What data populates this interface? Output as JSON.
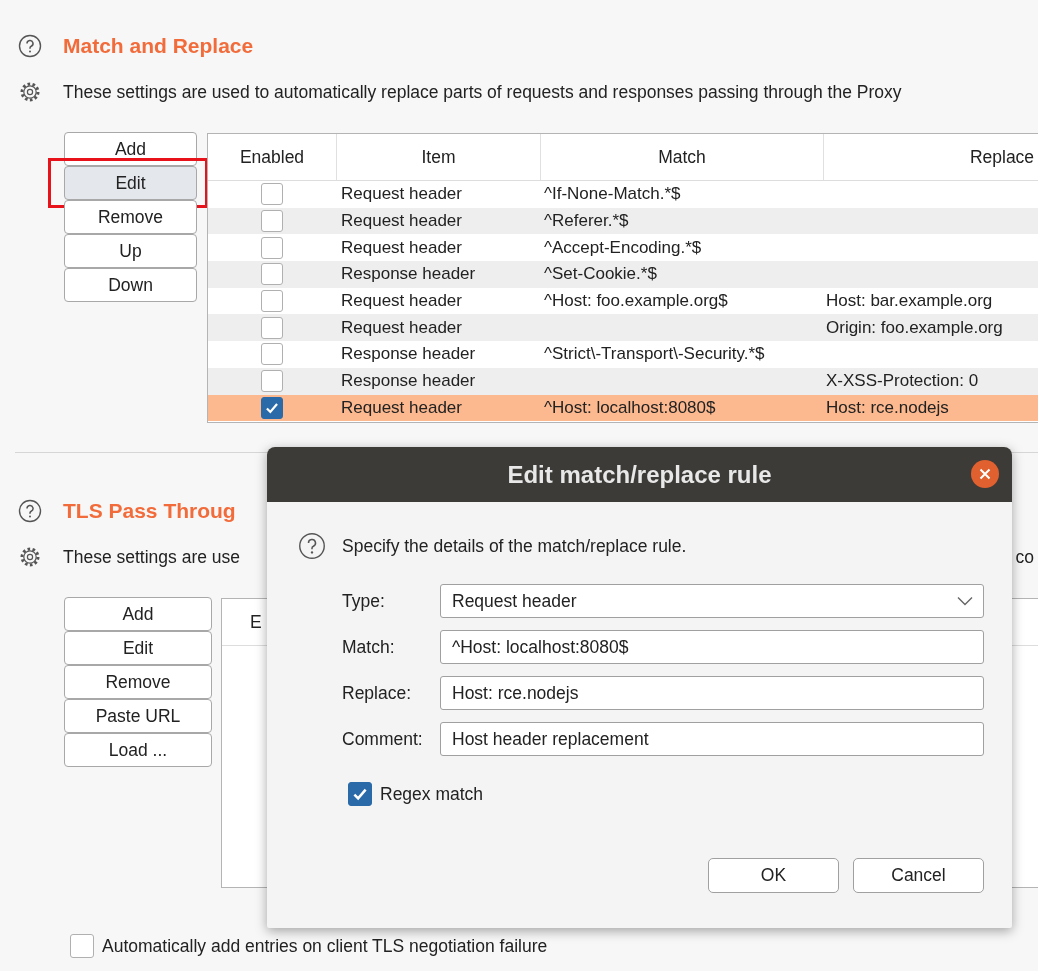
{
  "sections": [
    {
      "title": "Match and Replace",
      "description": "These settings are used to automatically replace parts of requests and responses passing through the Proxy",
      "buttons": [
        {
          "label": "Add",
          "annotated": false
        },
        {
          "label": "Edit",
          "annotated": true
        },
        {
          "label": "Remove",
          "annotated": false
        },
        {
          "label": "Up",
          "annotated": false
        },
        {
          "label": "Down",
          "annotated": false
        }
      ],
      "table": {
        "columns": [
          "Enabled",
          "Item",
          "Match",
          "Replace"
        ],
        "rows": [
          {
            "enabled": false,
            "item": "Request header",
            "match": "^If-None-Match.*$",
            "replace": "",
            "selected": false
          },
          {
            "enabled": false,
            "item": "Request header",
            "match": "^Referer.*$",
            "replace": "",
            "selected": false
          },
          {
            "enabled": false,
            "item": "Request header",
            "match": "^Accept-Encoding.*$",
            "replace": "",
            "selected": false
          },
          {
            "enabled": false,
            "item": "Response header",
            "match": "^Set-Cookie.*$",
            "replace": "",
            "selected": false
          },
          {
            "enabled": false,
            "item": "Request header",
            "match": "^Host: foo.example.org$",
            "replace": "Host: bar.example.org",
            "selected": false
          },
          {
            "enabled": false,
            "item": "Request header",
            "match": "",
            "replace": "Origin: foo.example.org",
            "selected": false
          },
          {
            "enabled": false,
            "item": "Response header",
            "match": "^Strict\\-Transport\\-Security.*$",
            "replace": "",
            "selected": false
          },
          {
            "enabled": false,
            "item": "Response header",
            "match": "",
            "replace": "X-XSS-Protection: 0",
            "selected": false
          },
          {
            "enabled": true,
            "item": "Request header",
            "match": "^Host: localhost:8080$",
            "replace": "Host: rce.nodejs",
            "selected": true
          }
        ]
      }
    },
    {
      "title": "TLS Pass Throug",
      "description": "These settings are use",
      "description_tail": "co",
      "buttons": [
        {
          "label": "Add",
          "annotated": false
        },
        {
          "label": "Edit",
          "annotated": false
        },
        {
          "label": "Remove",
          "annotated": false
        },
        {
          "label": "Paste URL",
          "annotated": false
        },
        {
          "label": "Load ...",
          "annotated": false
        }
      ],
      "table": {
        "columns": [
          "E"
        ]
      }
    }
  ],
  "footer_checkbox": {
    "label": "Automatically add entries on client TLS negotiation failure",
    "checked": false
  },
  "dialog": {
    "title": "Edit match/replace rule",
    "prompt": "Specify the details of the match/replace rule.",
    "fields": [
      {
        "label": "Type:",
        "kind": "dropdown",
        "value": "Request header"
      },
      {
        "label": "Match:",
        "kind": "text",
        "value": "^Host: localhost:8080$"
      },
      {
        "label": "Replace:",
        "kind": "text",
        "value": "Host: rce.nodejs"
      },
      {
        "label": "Comment:",
        "kind": "text",
        "value": "Host header replacement"
      }
    ],
    "regex": {
      "label": "Regex match",
      "checked": true
    },
    "buttons": [
      "OK",
      "Cancel"
    ]
  }
}
